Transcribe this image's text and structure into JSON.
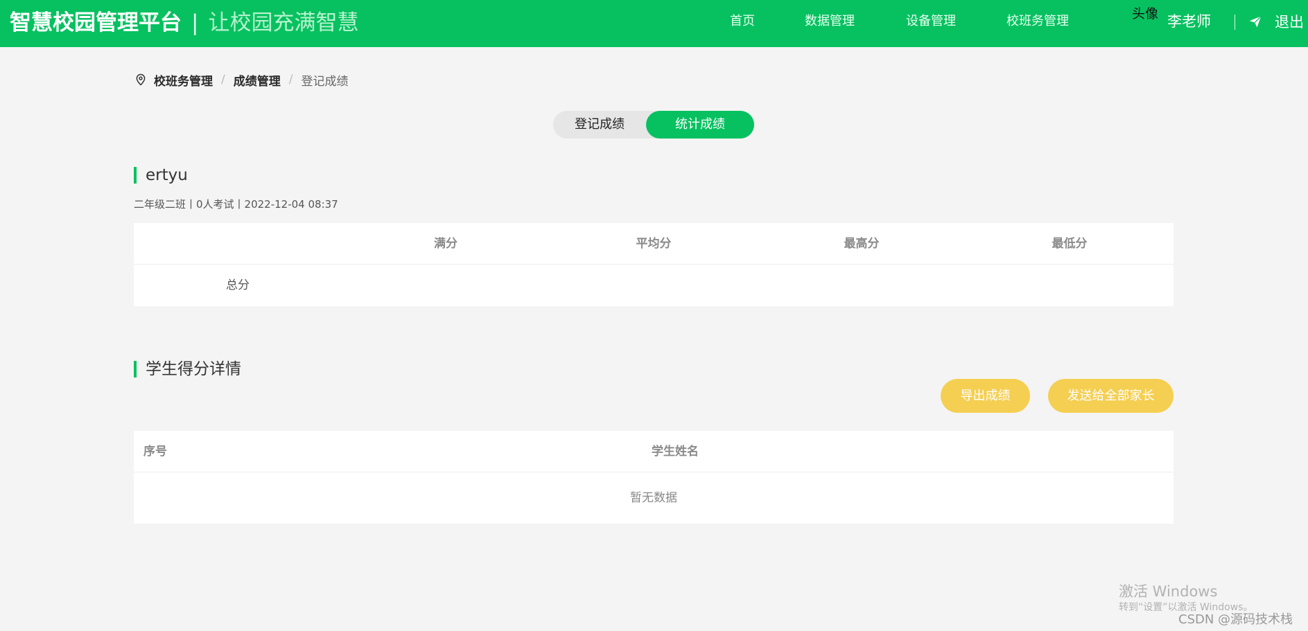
{
  "header": {
    "brand_main": "智慧校园管理平台",
    "brand_sep": "|",
    "brand_sub": "让校园充满智慧",
    "nav": [
      "首页",
      "数据管理",
      "设备管理",
      "校班务管理"
    ],
    "avatar_alt": "头像",
    "user_name": "李老师",
    "logout": "退出",
    "send_icon": "paper-plane-icon"
  },
  "breadcrumb": {
    "icon": "location-pin-icon",
    "items": [
      "校班务管理",
      "成绩管理",
      "登记成绩"
    ],
    "separator": "/"
  },
  "toggle": {
    "register": "登记成绩",
    "statistics": "统计成绩",
    "active": "统计成绩"
  },
  "exam": {
    "title": "ertyu",
    "meta": "二年级二班丨0人考试丨2022-12-04 08:37"
  },
  "stat_table": {
    "headers": [
      "",
      "满分",
      "平均分",
      "最高分",
      "最低分"
    ],
    "rows": [
      [
        "总分",
        "",
        "",
        "",
        ""
      ]
    ]
  },
  "details": {
    "title": "学生得分详情",
    "export_button": "导出成绩",
    "send_all_button": "发送给全部家长",
    "headers": [
      "序号",
      "学生姓名"
    ],
    "empty_text": "暂无数据"
  },
  "watermarks": {
    "windows_line1": "激活 Windows",
    "windows_line2": "转到“设置”以激活 Windows。",
    "csdn": "CSDN @源码技术栈"
  },
  "colors": {
    "brand_green": "#07c160",
    "button_yellow": "#f5cf52",
    "page_bg": "#f4f4f4"
  }
}
